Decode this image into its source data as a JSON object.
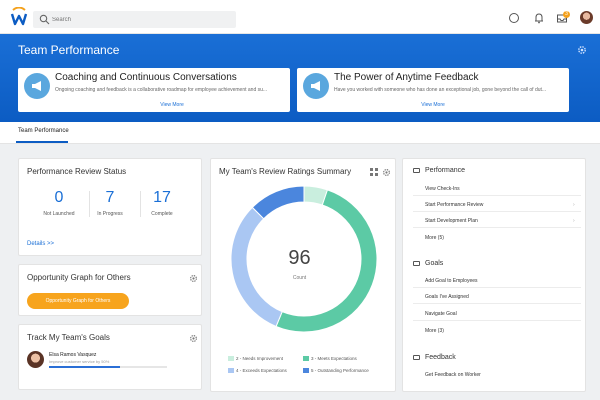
{
  "topbar": {
    "search_placeholder": "Search",
    "inbox_badge": "3",
    "icons": [
      "workday-logo",
      "search-icon",
      "chat-icon",
      "bell-icon",
      "inbox-icon",
      "user-avatar"
    ]
  },
  "header": {
    "title": "Team Performance",
    "promos": [
      {
        "title": "Coaching and Continuous Conversations",
        "description": "Ongoing coaching and feedback is a collaborative roadmap for employee achievement and su...",
        "link": "View More"
      },
      {
        "title": "The Power of Anytime Feedback",
        "description": "Have you worked with someone who has done an exceptional job, gone beyond the call of dut...",
        "link": "View More"
      }
    ]
  },
  "tabs": [
    {
      "label": "Team Performance",
      "active": true
    }
  ],
  "review_status": {
    "title": "Performance Review Status",
    "stats": [
      {
        "value": "0",
        "label": "Not Launched"
      },
      {
        "value": "7",
        "label": "In Progress"
      },
      {
        "value": "17",
        "label": "Complete"
      }
    ],
    "link": "Details >>"
  },
  "opportunity": {
    "title": "Opportunity Graph for Others",
    "button": "Opportunity Graph for Others"
  },
  "goals": {
    "title": "Track My Team's Goals",
    "person_name": "Elsa Ramos Vasquez",
    "person_goal": "Improve customer service by 50%",
    "progress": 0.6
  },
  "ratings": {
    "title": "My Team's Review Ratings Summary",
    "count": "96",
    "count_label": "Count",
    "legend": [
      {
        "label": "2 - Needs Improvement",
        "color": "#c9eede"
      },
      {
        "label": "3 - Meets Expectations",
        "color": "#5ccaa5"
      },
      {
        "label": "4 - Exceeds Expectations",
        "color": "#aac7f3"
      },
      {
        "label": "5 - Outstanding Performance",
        "color": "#4b86dd"
      }
    ]
  },
  "chart_data": {
    "type": "pie",
    "labels": [
      "2 - Needs Improvement",
      "3 - Meets Expectations",
      "4 - Exceeds Expectations",
      "5 - Outstanding Performance"
    ],
    "values": [
      5,
      49,
      30,
      12
    ],
    "total": 96,
    "colors": [
      "#c9eede",
      "#5ccaa5",
      "#aac7f3",
      "#4b86dd"
    ],
    "legend": "bottom"
  },
  "right_panel": {
    "sections": [
      {
        "title": "Performance",
        "items": [
          "View Check-Ins",
          "Start Performance Review",
          "Start Development Plan",
          "More (5)"
        ]
      },
      {
        "title": "Goals",
        "items": [
          "Add Goal to Employees",
          "Goals I've Assigned",
          "Navigate Goal",
          "More (3)"
        ]
      },
      {
        "title": "Feedback",
        "items": [
          "Get Feedback on Worker"
        ]
      }
    ]
  },
  "colors": {
    "brand_blue": "#0c5cc3",
    "accent_orange": "#f7a41d",
    "link_blue": "#1a6fd6"
  }
}
